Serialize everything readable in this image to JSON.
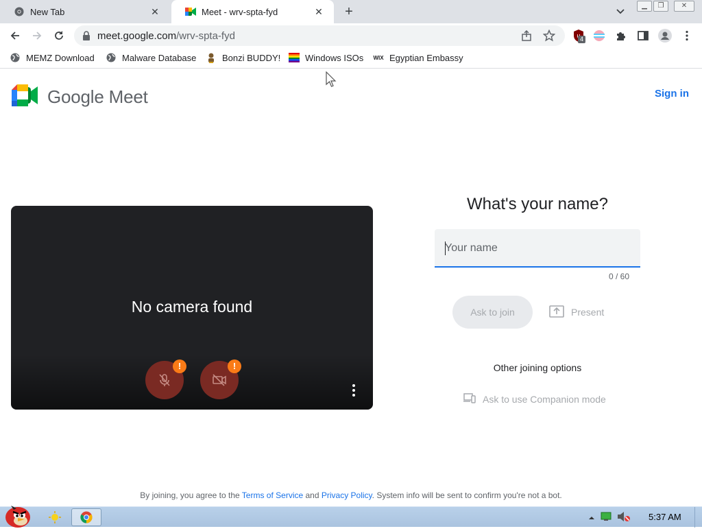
{
  "browser": {
    "tabs": [
      {
        "title": "New Tab",
        "icon": "chrome-icon",
        "active": false
      },
      {
        "title": "Meet - wrv-spta-fyd",
        "icon": "meet-icon",
        "active": true
      }
    ],
    "url": {
      "host": "meet.google.com",
      "path": "/wrv-spta-fyd"
    },
    "extension_badge": "4",
    "bookmarks": [
      {
        "label": "MEMZ Download",
        "icon": "globe-icon"
      },
      {
        "label": "Malware Database",
        "icon": "globe-icon"
      },
      {
        "label": "Bonzi BUDDY!",
        "icon": "bonzi-icon"
      },
      {
        "label": "Windows ISOs",
        "icon": "rainbow-flag-icon"
      },
      {
        "label": "Egyptian Embassy",
        "icon": "wix-icon"
      }
    ]
  },
  "meet": {
    "brand": "Google Meet",
    "sign_in": "Sign in",
    "preview": {
      "status": "No camera found",
      "mic_warning": "!",
      "cam_warning": "!"
    },
    "join": {
      "heading": "What's your name?",
      "name_placeholder": "Your name",
      "name_value": "",
      "counter": "0 / 60",
      "ask_button": "Ask to join",
      "present_button": "Present",
      "other_options": "Other joining options",
      "companion": "Ask to use Companion mode"
    },
    "footer": {
      "prefix": "By joining, you agree to the",
      "terms": "Terms of Service",
      "and": "and",
      "privacy": "Privacy Policy",
      "suffix": ". System info will be sent to confirm you're not a bot."
    }
  },
  "taskbar": {
    "clock": "5:37 AM"
  },
  "colors": {
    "accent": "#1a73e8",
    "preview_bg": "#202124",
    "control_red": "#7a2a23",
    "warning_orange": "#fa7b17",
    "taskbar": "#b9d1ea"
  }
}
